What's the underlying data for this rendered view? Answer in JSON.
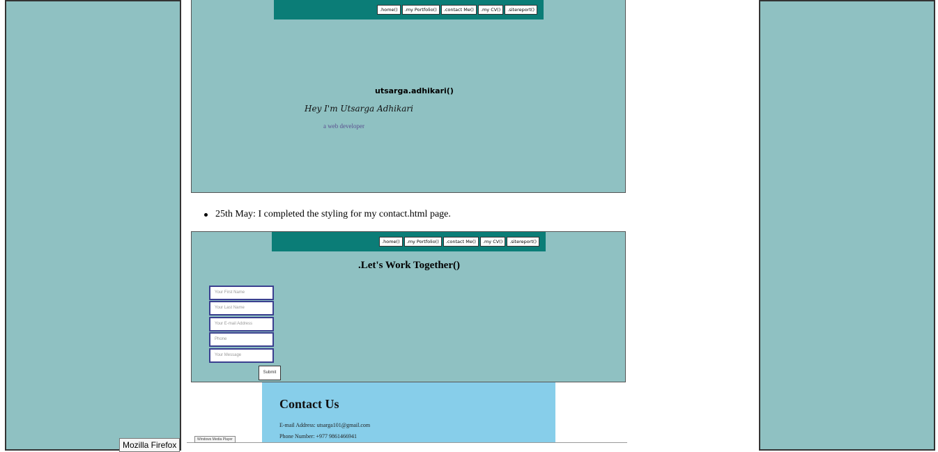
{
  "nav_links": [
    ".home()",
    ".my Portfolio()",
    ".contact Me()",
    ".my CV()",
    ".sitereport()"
  ],
  "home_preview": {
    "title": "utsarga.adhikari()",
    "greeting": "Hey I'm Utsarga Adhikari",
    "subtitle": "a web developer"
  },
  "log_entry": "25th May: I completed the styling for my contact.html page.",
  "contact_preview": {
    "heading": ".Let's Work Together()",
    "fields": [
      "Your First Name",
      "Your Last Name",
      "Your E-mail Address",
      "Phone",
      "Your Message"
    ],
    "submit": "Submit"
  },
  "contact_card": {
    "title": "Contact Us",
    "email_line": "E-mail Address: utsarga101@gmail.com",
    "phone_line": "Phone Number: +977 9861466941"
  },
  "media_tag": "Windows Media Player",
  "tooltip": "Mozilla Firefox",
  "colors": {
    "panel_bg": "#8fc1c2",
    "nav_bg": "#0b7d77",
    "card_bg": "#87ceea",
    "field_border": "#3a3f8f"
  }
}
